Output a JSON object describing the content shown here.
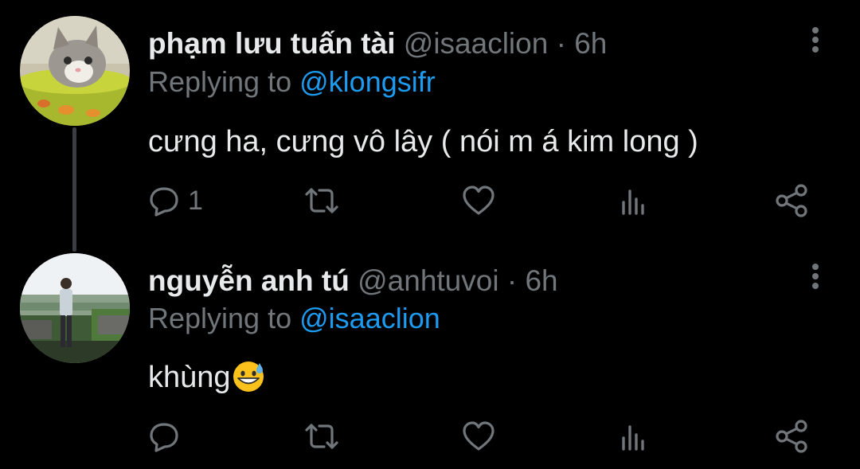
{
  "tweets": [
    {
      "display_name": "phạm lưu tuấn tài",
      "handle": "@isaaclion",
      "separator": "·",
      "time": "6h",
      "replying_prefix": "Replying to",
      "replying_to": "@klongsifr",
      "text": "cưng ha, cưng vô lây ( nói m á kim long )",
      "reply_count": "1",
      "avatar_icon": "kitten-avatar"
    },
    {
      "display_name": "nguyễn anh tú",
      "handle": "@anhtuvoi",
      "separator": "·",
      "time": "6h",
      "replying_prefix": "Replying to",
      "replying_to": "@isaaclion",
      "text": "khùng",
      "reply_count": "",
      "emoji": "grinning-face-with-sweat-emoji",
      "avatar_icon": "person-landscape-avatar"
    }
  ],
  "colors": {
    "background": "#000000",
    "primary_text": "#e7e9ea",
    "secondary_text": "#71767b",
    "accent": "#1d9bf0",
    "thread_line": "#3a3d41"
  },
  "icons": [
    "reply-icon",
    "retweet-icon",
    "like-icon",
    "views-icon",
    "share-icon",
    "more-icon"
  ]
}
